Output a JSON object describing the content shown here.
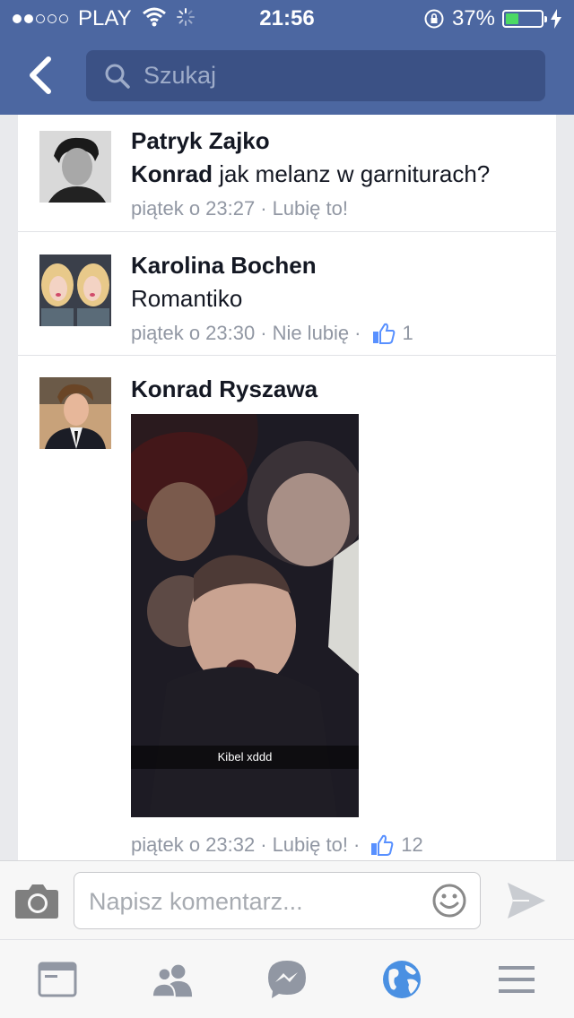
{
  "status_bar": {
    "carrier": "PLAY",
    "time": "21:56",
    "battery": "37%"
  },
  "nav": {
    "search_placeholder": "Szukaj"
  },
  "comments": [
    {
      "author": "Patryk Zajko",
      "mention": "Konrad",
      "text": " jak melanz w garniturach?",
      "time": "piątek o 23:27",
      "action": "Lubię to!"
    },
    {
      "author": "Karolina Bochen",
      "text": "Romantiko",
      "time": "piątek o 23:30",
      "action": "Nie lubię",
      "like_count": "1"
    },
    {
      "author": "Konrad Ryszawa",
      "photo_caption": "Kibel xddd",
      "time": "piątek o 23:32",
      "action": "Lubię to!",
      "like_count": "12"
    }
  ],
  "compose": {
    "placeholder": "Napisz komentarz..."
  },
  "colors": {
    "header": "#4c67a1",
    "search_bg": "#3b5185",
    "active_tab": "#4a90e2",
    "inactive_tab": "#9197a3"
  }
}
